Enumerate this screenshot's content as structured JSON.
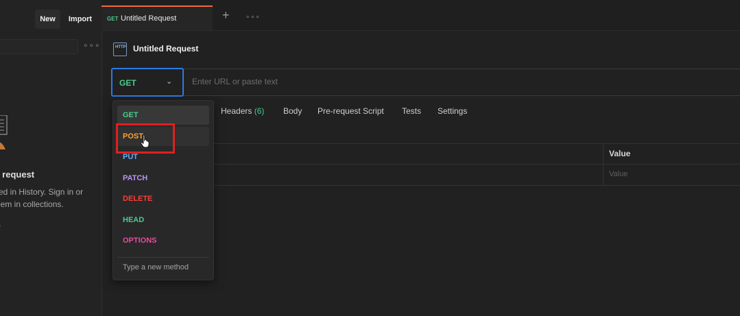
{
  "sidebar": {
    "new_label": "New",
    "import_label": "Import",
    "more_icon": "ellipsis-icon",
    "empty_title": "st request",
    "empty_line1": "red in History. Sign in or",
    "empty_line2": "hem in collections.",
    "link_text": "w"
  },
  "tabs": [
    {
      "method": "GET",
      "title": "Untitled Request"
    }
  ],
  "tabbar": {
    "add_label": "+",
    "more_label": "∘∘∘"
  },
  "request": {
    "title": "Untitled Request",
    "icon_text": "HTTP",
    "method": "GET",
    "url_placeholder": "Enter URL or paste text"
  },
  "subtabs": {
    "headers": "Headers",
    "headers_count": "(6)",
    "body": "Body",
    "prerequest": "Pre-request Script",
    "tests": "Tests",
    "settings": "Settings"
  },
  "params_table": {
    "value_header": "Value",
    "value_placeholder": "Value"
  },
  "method_dropdown": {
    "items": [
      {
        "label": "GET",
        "color": "#49cc90"
      },
      {
        "label": "POST",
        "color": "#fca130"
      },
      {
        "label": "PUT",
        "color": "#61affe"
      },
      {
        "label": "PATCH",
        "color": "#b794f6"
      },
      {
        "label": "DELETE",
        "color": "#f93e3e"
      },
      {
        "label": "HEAD",
        "color": "#49cc90"
      },
      {
        "label": "OPTIONS",
        "color": "#e64ba0"
      }
    ],
    "selected": "GET",
    "hovered": "POST",
    "new_method_label": "Type a new method"
  },
  "colors": {
    "accent": "#f26b3a",
    "focus": "#2c7be5",
    "highlight": "#e02020"
  }
}
